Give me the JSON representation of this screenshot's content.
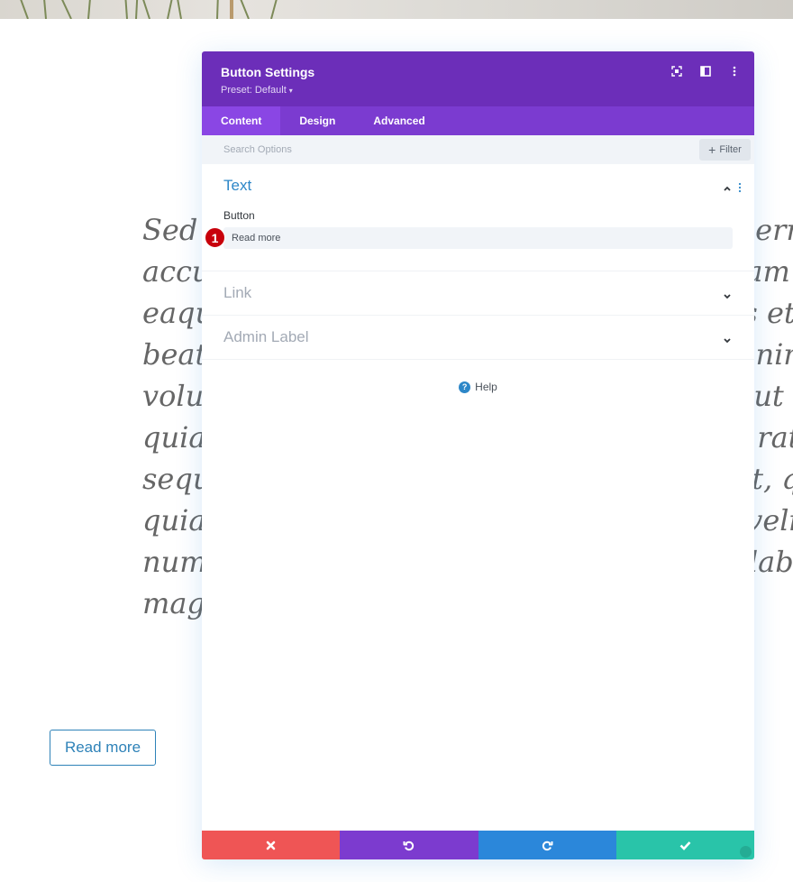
{
  "background": {
    "paragraph_lines": [
      "Sed ut perspiciatis unde omnis iste natus error sit volup",
      "accusantium doloremque laudantium, totam rem aperi",
      "eaque ipsa quae ab illo inventore veritatis et quasi archi",
      "beatae vitae dicta sunt explicabo. Nemo enim ipsam",
      "voluptatem quia voluptas sit aspernatur aut odit aut fu",
      "quia consequuntur magni dolores eos qui ratione volup",
      "sequi nesciunt. Neque porro quisquam est, qui dolorem",
      "quia dolor sit amet, consectetur, adipisci velit, sed quia",
      "numquam eius modi tempora incidunt ut labore et dolo",
      "magnam aliquam quaerat voluptatem."
    ],
    "read_more_button": "Read more"
  },
  "panel": {
    "title": "Button Settings",
    "preset": "Preset: Default",
    "header_icons": [
      "fullscreen-icon",
      "split-view-icon",
      "more-options-icon"
    ],
    "tabs": [
      {
        "label": "Content",
        "active": true
      },
      {
        "label": "Design",
        "active": false
      },
      {
        "label": "Advanced",
        "active": false
      }
    ],
    "search": {
      "placeholder": "Search Options",
      "value": ""
    },
    "filter_label": "Filter",
    "sections": {
      "text": {
        "title": "Text",
        "expanded": true,
        "field_label": "Button",
        "field_value": "Read more",
        "marker": "1"
      },
      "link": {
        "title": "Link",
        "expanded": false
      },
      "admin_label": {
        "title": "Admin Label",
        "expanded": false
      }
    },
    "help_label": "Help",
    "footer": {
      "cancel": "cancel-icon",
      "undo": "undo-icon",
      "redo": "redo-icon",
      "save": "check-icon"
    },
    "colors": {
      "header": "#6c2eb9",
      "tabs": "#7b3bd0",
      "active_tab": "#8a46e4",
      "accent_blue": "#2d87c8",
      "cancel": "#ef5555",
      "undo": "#7c3bcf",
      "redo": "#2b87da",
      "save": "#29c4a9"
    }
  }
}
